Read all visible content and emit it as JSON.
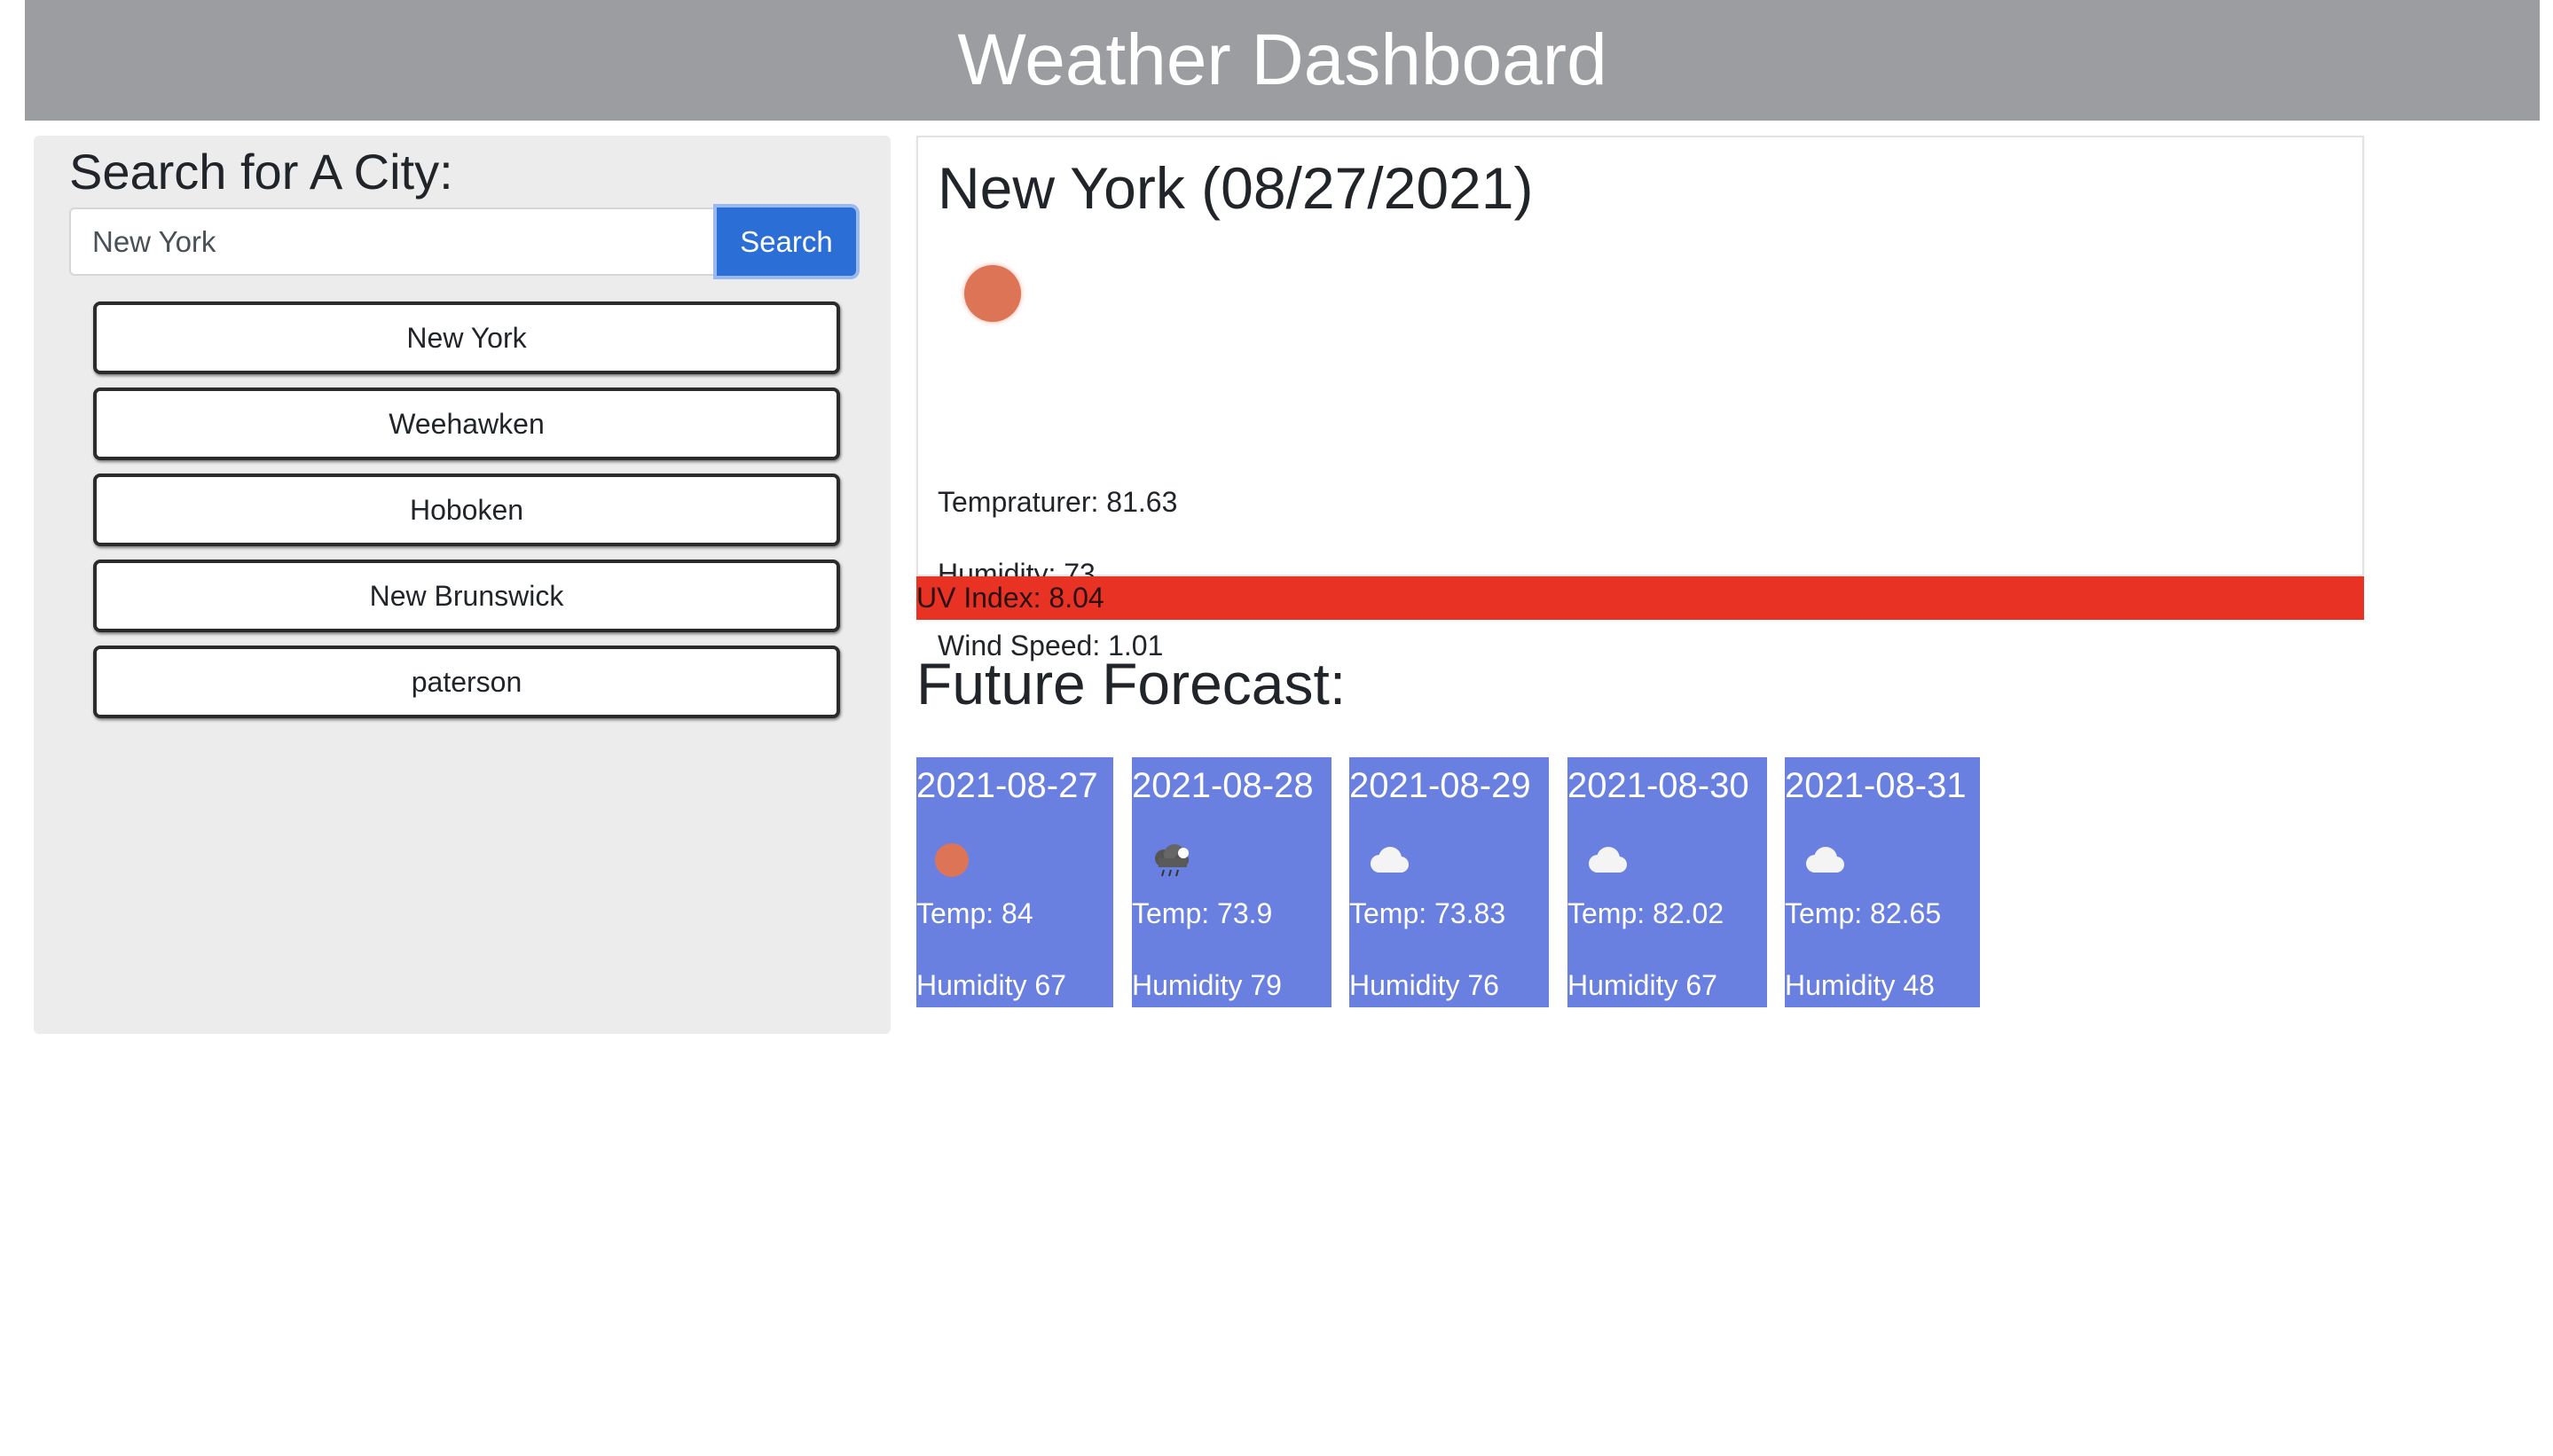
{
  "header": {
    "title": "Weather Dashboard"
  },
  "search": {
    "heading": "Search for A City:",
    "input_value": "New York",
    "button_label": "Search"
  },
  "history": [
    {
      "label": "New York"
    },
    {
      "label": "Weehawken"
    },
    {
      "label": "Hoboken"
    },
    {
      "label": "New Brunswick"
    },
    {
      "label": "paterson"
    }
  ],
  "current": {
    "title": "New York (08/27/2021)",
    "icon": "sun-icon",
    "temperature": "Tempraturer: 81.63",
    "humidity": "Humidity: 73",
    "wind": "Wind Speed: 1.01",
    "uv": "UV Index: 8.04"
  },
  "forecast": {
    "title": "Future Forecast:",
    "days": [
      {
        "date": "2021-08-27",
        "icon": "sun-icon",
        "temp": "Temp: 84",
        "humidity": "Humidity 67"
      },
      {
        "date": "2021-08-28",
        "icon": "thunderstorm-icon",
        "temp": "Temp: 73.9",
        "humidity": "Humidity 79"
      },
      {
        "date": "2021-08-29",
        "icon": "cloud-icon",
        "temp": "Temp: 73.83",
        "humidity": "Humidity 76"
      },
      {
        "date": "2021-08-30",
        "icon": "cloud-icon",
        "temp": "Temp: 82.02",
        "humidity": "Humidity 67"
      },
      {
        "date": "2021-08-31",
        "icon": "cloud-icon",
        "temp": "Temp: 82.65",
        "humidity": "Humidity 48"
      }
    ]
  },
  "colors": {
    "header_bg": "#9c9da1",
    "search_button": "#2b6fd6",
    "uv_high": "#e83224",
    "forecast_card": "#6a80e0",
    "sun": "#de7456"
  }
}
